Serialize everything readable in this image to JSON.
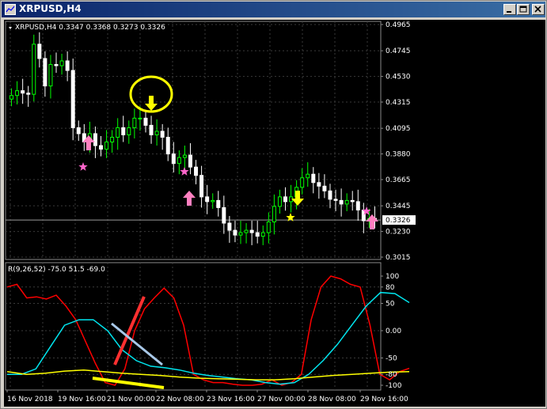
{
  "window": {
    "title": "XRPUSD,H4"
  },
  "main_chart": {
    "symbol_header": "XRPUSD,H4  0.3347 0.3368 0.3273 0.3326",
    "price_levels": [
      "0.4965",
      "0.4745",
      "0.4530",
      "0.4315",
      "0.4095",
      "0.3880",
      "0.3665",
      "0.3445",
      "0.3230",
      "0.3015"
    ],
    "current_price_label": "0.3326",
    "colors": {
      "up_candle": "#00ff00",
      "down_candle": "#ffffff",
      "background": "#000000",
      "grid": "#3a3a3a"
    }
  },
  "indicator": {
    "label": "R(9,26,52) -75.0 51.5 -69.0",
    "levels": [
      "100",
      "80",
      "50",
      "0.00",
      "-50",
      "-80",
      "-100"
    ],
    "colors": {
      "line1": "#ff0000",
      "line2": "#00e5ee",
      "line3": "#ffff00"
    }
  },
  "time_axis": [
    "16 Nov 2018",
    "19 Nov 16:00",
    "21 Nov 00:00",
    "22 Nov 08:00",
    "23 Nov 16:00",
    "27 Nov 00:00",
    "28 Nov 08:00",
    "29 Nov 16:00"
  ],
  "markers": {
    "buy_arrow_color": "#ff80c0",
    "sell_arrow_color": "#ffff00",
    "star_pink": "#ff66cc",
    "star_yellow": "#ffff00"
  },
  "chart_data": {
    "type": "candlestick",
    "symbol": "XRPUSD",
    "timeframe": "H4",
    "ohlc_header": {
      "open": 0.3347,
      "high": 0.3368,
      "low": 0.3273,
      "close": 0.3326
    },
    "ylim": [
      0.3015,
      0.4965
    ],
    "indicator_ylim": [
      -100,
      100
    ],
    "closes": [
      0.437,
      0.441,
      0.439,
      0.438,
      0.48,
      0.468,
      0.445,
      0.463,
      0.462,
      0.466,
      0.458,
      0.41,
      0.405,
      0.398,
      0.405,
      0.395,
      0.392,
      0.398,
      0.402,
      0.41,
      0.404,
      0.41,
      0.418,
      0.418,
      0.412,
      0.404,
      0.407,
      0.402,
      0.388,
      0.38,
      0.385,
      0.387,
      0.377,
      0.37,
      0.352,
      0.348,
      0.349,
      0.343,
      0.33,
      0.324,
      0.32,
      0.322,
      0.324,
      0.322,
      0.319,
      0.322,
      0.331,
      0.344,
      0.352,
      0.348,
      0.352,
      0.36,
      0.368,
      0.371,
      0.364,
      0.361,
      0.357,
      0.35,
      0.349,
      0.346,
      0.349,
      0.348,
      0.341,
      0.332,
      0.334,
      0.333
    ],
    "indicator_series": [
      {
        "color": "red",
        "values": [
          80,
          85,
          60,
          62,
          58,
          65,
          45,
          20,
          -20,
          -60,
          -95,
          -100,
          -70,
          0,
          40,
          60,
          78,
          60,
          10,
          -80,
          -90,
          -95,
          -95,
          -98,
          -100,
          -100,
          -98,
          -90,
          -100,
          -95,
          -80,
          20,
          80,
          100,
          95,
          85,
          80,
          10,
          -80,
          -90,
          -75,
          -69
        ]
      },
      {
        "color": "cyan",
        "values": [
          -80,
          -80,
          -70,
          -30,
          10,
          20,
          20,
          0,
          -35,
          -55,
          -65,
          -68,
          -72,
          -78,
          -82,
          -85,
          -88,
          -90,
          -95,
          -98,
          -95,
          -80,
          -55,
          -25,
          10,
          45,
          70,
          68,
          51.5
        ]
      },
      {
        "color": "yellow",
        "values": [
          -75,
          -80,
          -78,
          -74,
          -72,
          -75,
          -78,
          -80,
          -82,
          -85,
          -87,
          -88,
          -89,
          -90,
          -90,
          -88,
          -85,
          -82,
          -80,
          -78,
          -76,
          -75
        ]
      }
    ],
    "annotations": [
      "buy arrows",
      "sell arrows",
      "stars",
      "yellow circle",
      "drawn trend lines"
    ]
  }
}
